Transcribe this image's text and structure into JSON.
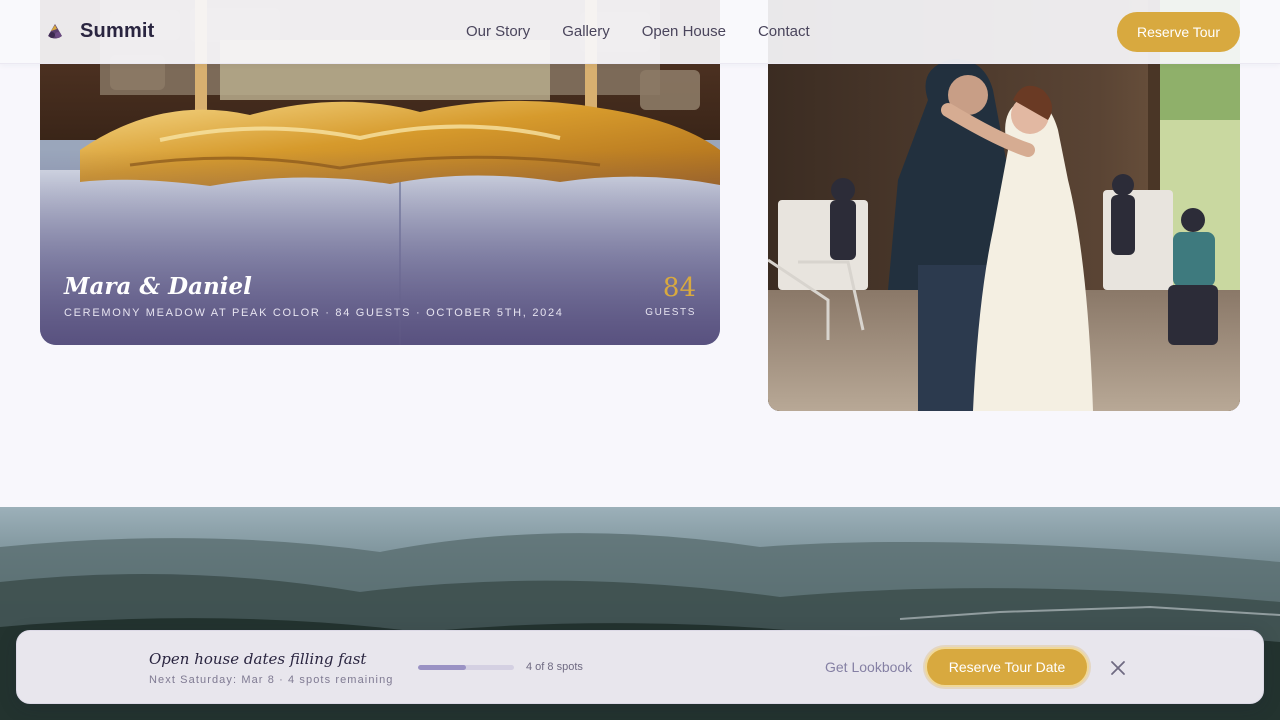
{
  "nav": {
    "brand_name": "Summit",
    "brand_icon": "mountain-leaf-icon",
    "links": [
      "Our Story",
      "Gallery",
      "Open House",
      "Contact"
    ],
    "cta_label": "Reserve Tour"
  },
  "feature_card": {
    "title": "Mara & Daniel",
    "meta": "Ceremony meadow at peak color · 84 guests · October 5th, 2024",
    "guest_count": "84",
    "guest_label": "GUESTS"
  },
  "promo_bar": {
    "title": "Open house dates filling fast",
    "subtitle": "Next Saturday: Mar 8 · 4 spots remaining",
    "progress": {
      "filled": 4,
      "total": 8,
      "label": "4 of 8 spots"
    },
    "lookbook_label": "Get Lookbook",
    "cta_label": "Reserve Tour Date",
    "close_icon": "close-icon"
  },
  "colors": {
    "accent_gold": "#d8a93f",
    "text_dark": "#2a2540",
    "progress_fill": "#9a92c4",
    "page_background": "#f8f7fc"
  }
}
